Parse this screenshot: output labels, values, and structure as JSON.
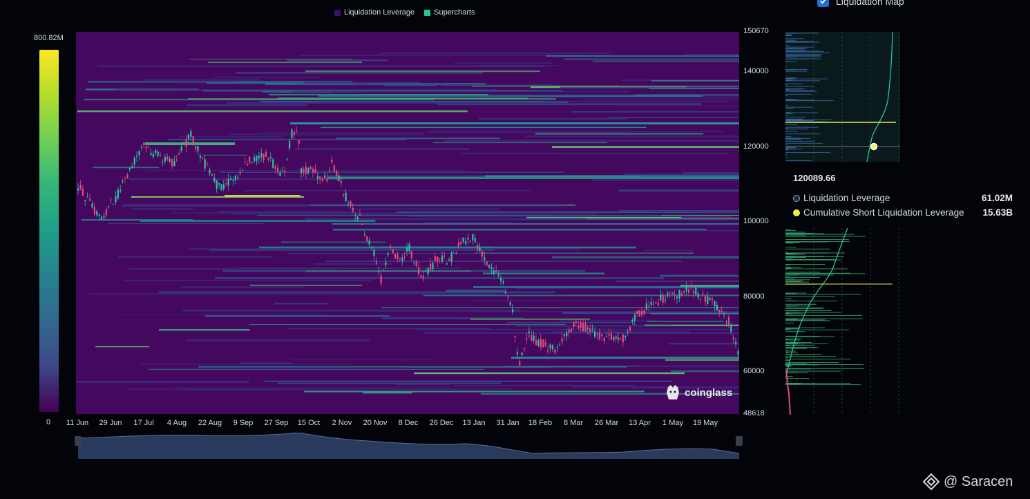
{
  "legend": {
    "items": [
      {
        "label": "Liquidation Leverage",
        "color": "#3b1360"
      },
      {
        "label": "Supercharts",
        "color": "#22c98a"
      }
    ]
  },
  "toggle": {
    "label": "Liquidation Map",
    "checked": true
  },
  "color_scale": {
    "max_label": "800.82M",
    "min_label": "0"
  },
  "y_axis": {
    "labels": [
      "150670",
      "140000",
      "120000",
      "100000",
      "80000",
      "60000",
      "48618"
    ]
  },
  "x_axis": {
    "labels": [
      "11 Jun",
      "29 Jun",
      "17 Jul",
      "4 Aug",
      "22 Aug",
      "9 Sep",
      "27 Sep",
      "15 Oct",
      "2 Nov",
      "20 Nov",
      "8 Dec",
      "26 Dec",
      "13 Jan",
      "31 Jan",
      "18 Feb",
      "8 Mar",
      "26 Mar",
      "13 Apr",
      "1 May",
      "19 May"
    ]
  },
  "watermark": {
    "text": "coinglass",
    "icon": "coinglass-logo-icon"
  },
  "tooltip": {
    "price": "120089.66",
    "rows": [
      {
        "label": "Liquidation Leverage",
        "value": "61.02M",
        "color": "#1c2a4a"
      },
      {
        "label": "Cumulative Short Liquidation Leverage",
        "value": "15.63B",
        "color": "#f0f040"
      }
    ]
  },
  "credit": {
    "text": "@ Saracen",
    "icon": "binance-square-icon"
  },
  "colors": {
    "background": "#02040a",
    "heat_base": "#44085e",
    "accent_green": "#22c98a",
    "accent_yellow": "#f0f040",
    "candle_up": "#2ec4a0",
    "candle_down": "#e8497a"
  }
}
